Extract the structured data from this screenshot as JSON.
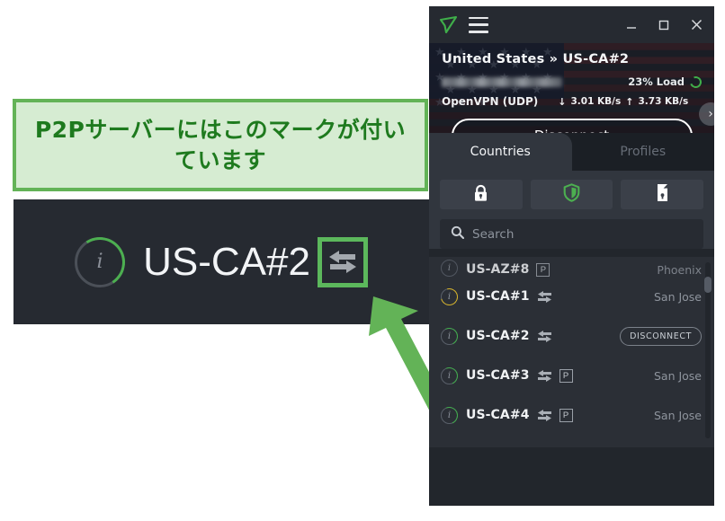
{
  "annotation": {
    "callout_text": "P2Pサーバーにはこのマークが付いています",
    "zoom_detail": {
      "server_name": "US-CA#2",
      "info_glyph": "i",
      "p2p_icon": "bidirectional-arrows-icon",
      "highlight_color": "#5cb85c"
    },
    "pointer_color": "#63b357"
  },
  "vpn": {
    "titlebar": {
      "logo": "app-logo-icon",
      "menu": "hamburger-menu-icon",
      "minimize": "minimize-icon",
      "maximize": "maximize-icon",
      "close": "close-icon"
    },
    "header": {
      "connection_title": "United States » US-CA#2",
      "ip_address": "",
      "load_label": "23% Load",
      "load_percent": 23,
      "protocol": "OpenVPN (UDP)",
      "download_arrow": "↓",
      "download_speed": "3.01 KB/s",
      "upload_arrow": "↑",
      "upload_speed": "3.73 KB/s",
      "next_chevron": "›",
      "disconnect_label": "Disconnect"
    },
    "tabs": [
      {
        "label": "Countries",
        "active": true
      },
      {
        "label": "Profiles",
        "active": false
      }
    ],
    "quick_buttons": [
      {
        "name": "padlock-icon",
        "label": ""
      },
      {
        "name": "shield-icon",
        "label": ""
      },
      {
        "name": "device-icon",
        "label": ""
      }
    ],
    "search": {
      "icon": "search-icon",
      "placeholder": "Search",
      "value": ""
    },
    "servers": [
      {
        "name": "US-AZ#8",
        "p2p": false,
        "profile_badge": "P",
        "city": "Phoenix",
        "action": "",
        "load_color": "#5a606a",
        "load_pct": 0,
        "clipped": true
      },
      {
        "name": "US-CA#1",
        "p2p": true,
        "profile_badge": "",
        "city": "San Jose",
        "action": "",
        "load_color": "#d7b325",
        "load_pct": 62,
        "clipped": false
      },
      {
        "name": "US-CA#2",
        "p2p": true,
        "profile_badge": "",
        "city": "",
        "action": "DISCONNECT",
        "load_color": "#3fae4a",
        "load_pct": 23,
        "clipped": false
      },
      {
        "name": "US-CA#3",
        "p2p": true,
        "profile_badge": "P",
        "city": "San Jose",
        "action": "",
        "load_color": "#3fae4a",
        "load_pct": 30,
        "clipped": false
      },
      {
        "name": "US-CA#4",
        "p2p": true,
        "profile_badge": "P",
        "city": "San Jose",
        "action": "",
        "load_color": "#3fae4a",
        "load_pct": 30,
        "clipped": false
      }
    ]
  }
}
